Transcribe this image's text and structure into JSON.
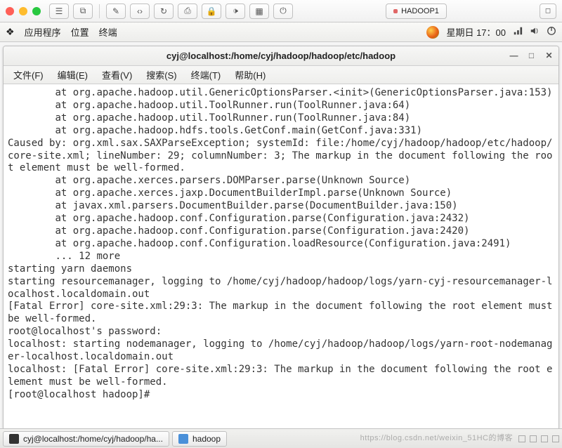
{
  "mac_toolbar": {
    "tab_label": "HADOOP1"
  },
  "gnome_panel": {
    "apps": "应用程序",
    "places": "位置",
    "terminal": "终端",
    "clock": "星期日 17：00"
  },
  "window": {
    "title": "cyj@localhost:/home/cyj/hadoop/hadoop/etc/hadoop",
    "menu": {
      "file": "文件(F)",
      "edit": "编辑(E)",
      "view": "查看(V)",
      "search": "搜索(S)",
      "terminal": "终端(T)",
      "help": "帮助(H)"
    }
  },
  "terminal_output": "        at org.apache.hadoop.util.GenericOptionsParser.<init>(GenericOptionsParser.java:153)\n        at org.apache.hadoop.util.ToolRunner.run(ToolRunner.java:64)\n        at org.apache.hadoop.util.ToolRunner.run(ToolRunner.java:84)\n        at org.apache.hadoop.hdfs.tools.GetConf.main(GetConf.java:331)\nCaused by: org.xml.sax.SAXParseException; systemId: file:/home/cyj/hadoop/hadoop/etc/hadoop/core-site.xml; lineNumber: 29; columnNumber: 3; The markup in the document following the root element must be well-formed.\n        at org.apache.xerces.parsers.DOMParser.parse(Unknown Source)\n        at org.apache.xerces.jaxp.DocumentBuilderImpl.parse(Unknown Source)\n        at javax.xml.parsers.DocumentBuilder.parse(DocumentBuilder.java:150)\n        at org.apache.hadoop.conf.Configuration.parse(Configuration.java:2432)\n        at org.apache.hadoop.conf.Configuration.parse(Configuration.java:2420)\n        at org.apache.hadoop.conf.Configuration.loadResource(Configuration.java:2491)\n        ... 12 more\nstarting yarn daemons\nstarting resourcemanager, logging to /home/cyj/hadoop/hadoop/logs/yarn-cyj-resourcemanager-localhost.localdomain.out\n[Fatal Error] core-site.xml:29:3: The markup in the document following the root element must be well-formed.\nroot@localhost's password:\nlocalhost: starting nodemanager, logging to /home/cyj/hadoop/hadoop/logs/yarn-root-nodemanager-localhost.localdomain.out\nlocalhost: [Fatal Error] core-site.xml:29:3: The markup in the document following the root element must be well-formed.\n[root@localhost hadoop]#",
  "taskbar": {
    "task1": "cyj@localhost:/home/cyj/hadoop/ha...",
    "task2": "hadoop"
  },
  "watermark": "https://blog.csdn.net/weixin_51HC的博客"
}
